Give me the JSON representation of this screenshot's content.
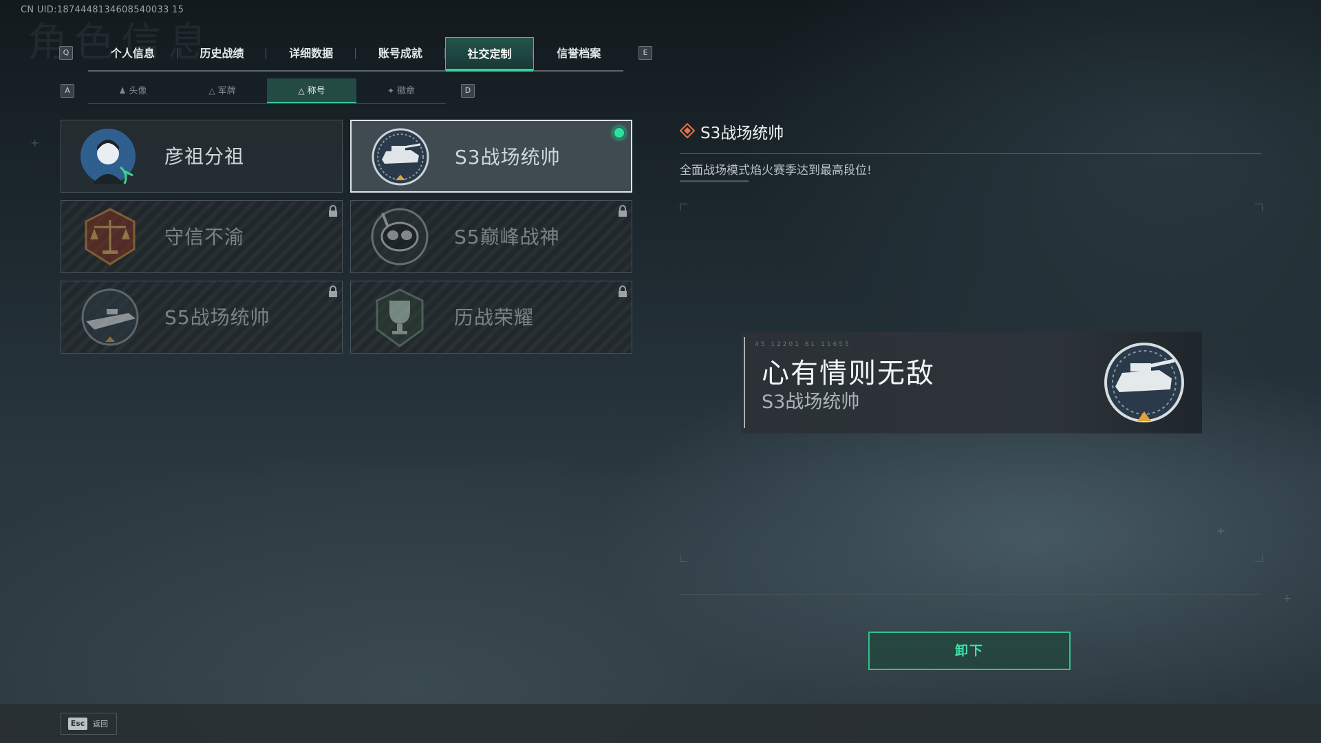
{
  "header": {
    "uid": "CN UID:1874448134608540033 15",
    "bg_title": "角色信息",
    "left_key": "Q",
    "right_key": "E"
  },
  "top_tabs": [
    {
      "label": "个人信息",
      "active": false
    },
    {
      "label": "历史战绩",
      "active": false
    },
    {
      "label": "详细数据",
      "active": false
    },
    {
      "label": "账号成就",
      "active": false
    },
    {
      "label": "社交定制",
      "active": true
    },
    {
      "label": "信誉档案",
      "active": false
    }
  ],
  "sub_tabs": {
    "left_key": "A",
    "right_key": "D",
    "items": [
      {
        "label": "头像",
        "icon": "person-icon",
        "active": false
      },
      {
        "label": "军牌",
        "icon": "dogtag-icon",
        "active": false
      },
      {
        "label": "称号",
        "icon": "title-icon",
        "active": true
      },
      {
        "label": "徽章",
        "icon": "badge-icon",
        "active": false
      }
    ]
  },
  "titles": [
    {
      "name": "彦祖分祖",
      "emblem": "portrait-icon",
      "locked": false,
      "selected": false
    },
    {
      "name": "S3战场统帅",
      "emblem": "tank-emblem-icon",
      "locked": false,
      "selected": true
    },
    {
      "name": "守信不渝",
      "emblem": "scales-emblem-icon",
      "locked": true,
      "selected": false
    },
    {
      "name": "S5巅峰战神",
      "emblem": "diver-emblem-icon",
      "locked": true,
      "selected": false
    },
    {
      "name": "S5战场统帅",
      "emblem": "boat-emblem-icon",
      "locked": true,
      "selected": false
    },
    {
      "name": "历战荣耀",
      "emblem": "trophy-emblem-icon",
      "locked": true,
      "selected": false
    }
  ],
  "detail": {
    "title": "S3战场统帅",
    "description": "全面战场模式焰火赛季达到最高段位!"
  },
  "preview": {
    "code": "45 12201 61 11655",
    "motto": "心有情则无敌",
    "title": "S3战场统帅"
  },
  "actions": {
    "unequip_label": "卸下",
    "esc_key": "Esc",
    "back_label": "返回"
  },
  "colors": {
    "accent": "#33d39e",
    "equipped_dot": "#2fe0a0"
  }
}
